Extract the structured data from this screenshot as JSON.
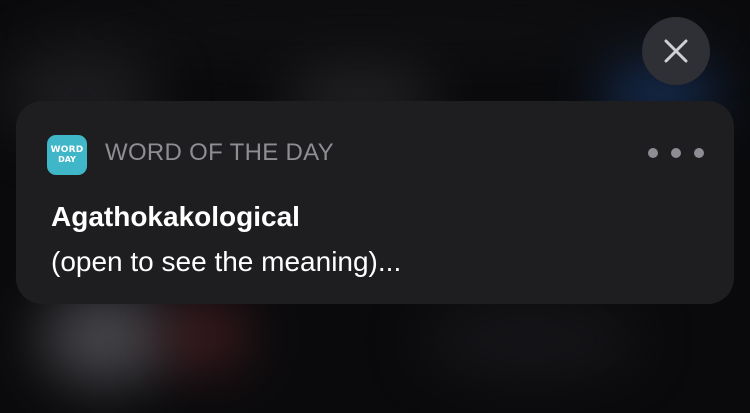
{
  "close_button": {
    "icon": "close-icon"
  },
  "notification": {
    "app": {
      "icon_line1": "WORD",
      "icon_line2": "DAY",
      "icon_color": "#40b6c9",
      "name": "WORD OF THE DAY"
    },
    "more_icon": "more-icon",
    "title": "Agathokakological",
    "body": "(open to see the meaning)..."
  }
}
